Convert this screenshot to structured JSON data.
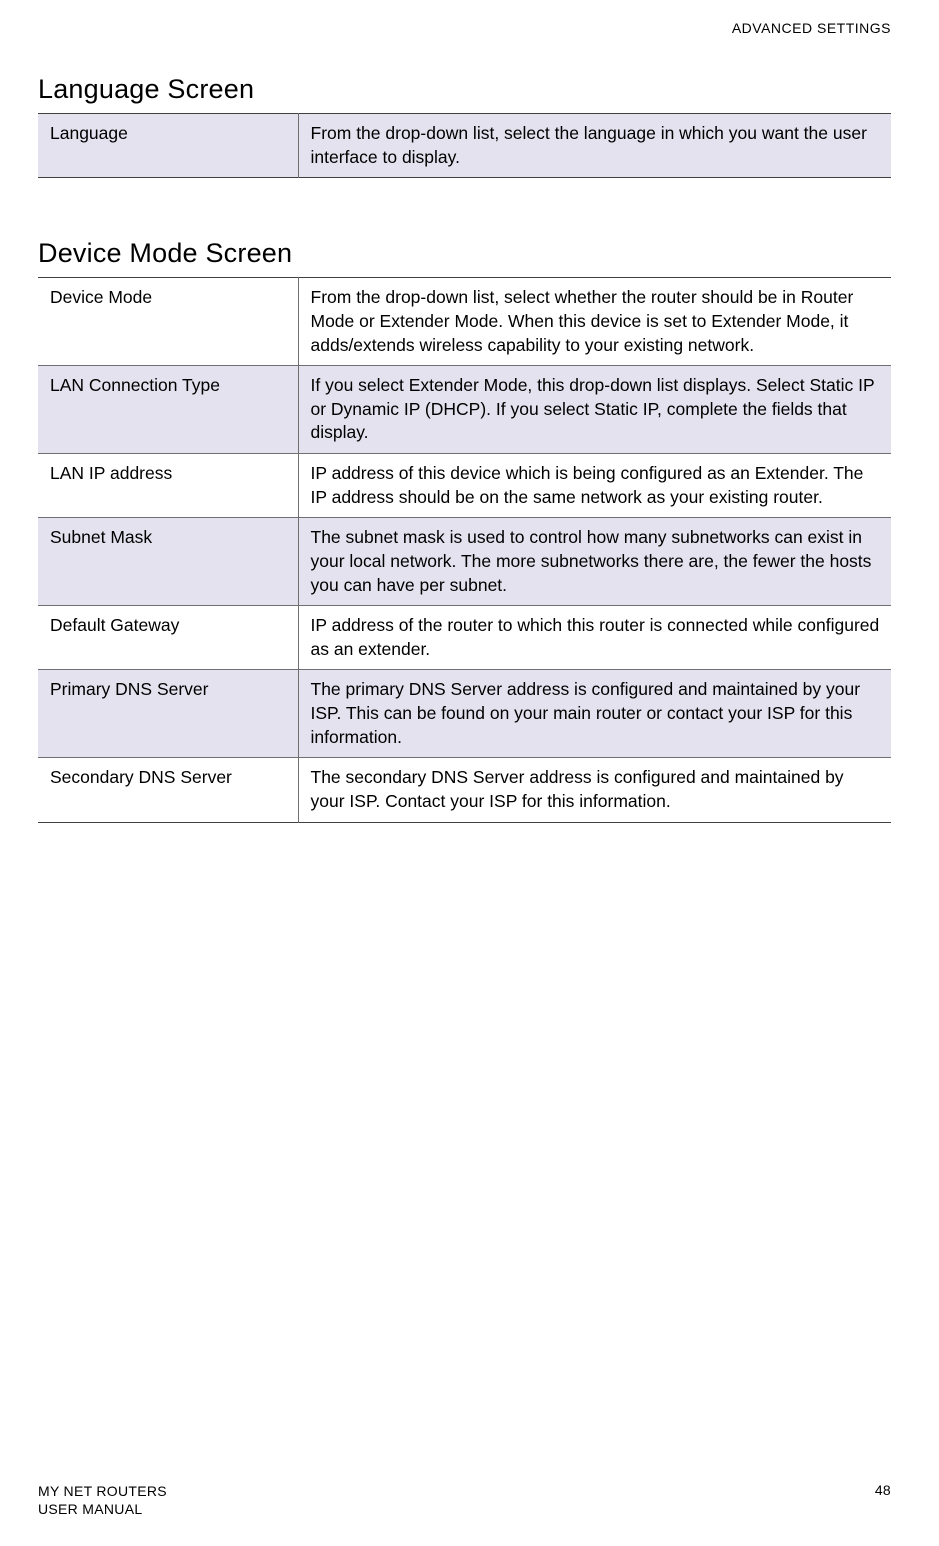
{
  "header": {
    "section": "ADVANCED SETTINGS"
  },
  "sections": [
    {
      "heading": "Language Screen",
      "rows": [
        {
          "shaded": true,
          "label": "Language",
          "desc": "From the drop-down list, select the language in which you want the user interface to display."
        }
      ]
    },
    {
      "heading": "Device Mode Screen",
      "rows": [
        {
          "shaded": false,
          "label": "Device Mode",
          "desc": "From the drop-down list, select whether the router should be in Router Mode or Extender Mode. When this device is set to Extender Mode, it adds/extends wireless capability to your existing network."
        },
        {
          "shaded": true,
          "label": "LAN Connection Type",
          "desc": "If you select Extender Mode, this drop-down list displays. Select Static IP or Dynamic IP (DHCP). If you select Static IP, complete the fields that display."
        },
        {
          "shaded": false,
          "label": "LAN IP address",
          "desc": "IP address of this device which is being configured as an Extender. The IP address should be on the same network as your existing router."
        },
        {
          "shaded": true,
          "label": "Subnet Mask",
          "desc": "The subnet mask is used to control how many subnetworks can exist in your local network. The more subnetworks there are, the fewer the hosts you can have per subnet."
        },
        {
          "shaded": false,
          "label": "Default Gateway",
          "desc": "IP address of the router to which this router is connected while configured as an extender."
        },
        {
          "shaded": true,
          "label": "Primary DNS Server",
          "desc": "The primary DNS Server address is configured and maintained by your ISP. This can be found on your main router or contact your ISP for this information."
        },
        {
          "shaded": false,
          "label": "Secondary DNS Server",
          "desc": "The secondary DNS Server address is configured and maintained by your ISP. Contact your ISP for this information."
        }
      ]
    }
  ],
  "footer": {
    "line1": "MY NET ROUTERS",
    "line2": "USER MANUAL",
    "page": "48"
  }
}
